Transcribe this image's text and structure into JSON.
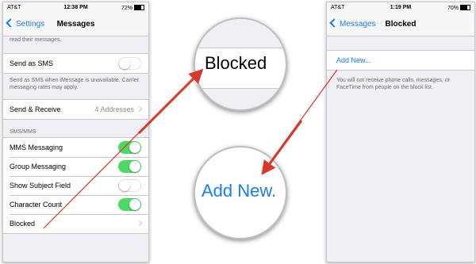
{
  "left_phone": {
    "status": {
      "carrier": "AT&T",
      "time": "12:38 PM",
      "battery": "72%"
    },
    "nav": {
      "back_label": "Settings",
      "title": "Messages"
    },
    "top_note": "read their messages.",
    "send_as_sms": {
      "label": "Send as SMS",
      "toggle": "off"
    },
    "sms_note": "Send as SMS when iMessage is unavailable. Carrier messaging rates may apply.",
    "send_receive": {
      "label": "Send & Receive",
      "detail": "4 Addresses"
    },
    "section_header": "SMS/MMS",
    "sms_items": [
      {
        "label": "MMS Messaging",
        "toggle": "on"
      },
      {
        "label": "Group Messaging",
        "toggle": "on"
      },
      {
        "label": "Show Subject Field",
        "toggle": "off"
      },
      {
        "label": "Character Count",
        "toggle": "on"
      }
    ],
    "blocked": {
      "label": "Blocked"
    }
  },
  "magnifiers": {
    "blocked_label": "Blocked",
    "add_new_label": "Add New."
  },
  "right_phone": {
    "status": {
      "carrier": "AT&T",
      "time": "1:19 PM",
      "battery": "70%"
    },
    "nav": {
      "back_label": "Messages",
      "title": "Blocked"
    },
    "add_new": "Add New...",
    "note": "You will not receive phone calls, messages, or FaceTime from people on the block list."
  },
  "colors": {
    "ios_blue": "#1a7cf5",
    "toggle_green": "#4cd964",
    "arrow_red": "#d9372a",
    "grouped_bg": "#efeff4"
  }
}
